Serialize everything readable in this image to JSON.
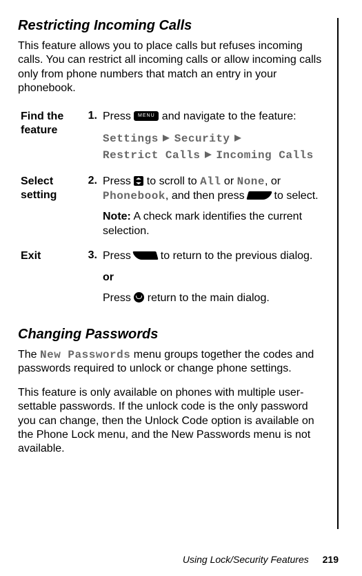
{
  "section1": {
    "title": "Restricting Incoming Calls",
    "intro": "This feature allows you to place calls but refuses incoming calls. You can restrict all incoming calls or allow incoming calls only from phone numbers that match an entry in your phonebook."
  },
  "steps": {
    "row1": {
      "label": "Find the feature",
      "num": "1.",
      "text_a": "Press ",
      "text_b": " and navigate to the feature:",
      "path_settings": "Settings",
      "path_security": "Security",
      "path_restrict": "Restrict Calls",
      "path_incoming": "Incoming Calls",
      "menu_key_label": "MENU"
    },
    "row2": {
      "label": "Select setting",
      "num": "2.",
      "text_a": "Press ",
      "text_b": " to scroll to ",
      "opt_all": "All",
      "text_c": " or ",
      "opt_none": "None",
      "text_d": ", or ",
      "opt_pb": "Phonebook",
      "text_e": ", and then press ",
      "text_f": " to select.",
      "note_label": "Note:",
      "note_text": " A check mark identifies the current selection."
    },
    "row3": {
      "label": "Exit",
      "num": "3.",
      "text_a": "Press ",
      "text_b": " to return to the previous dialog.",
      "or": "or",
      "text_c": "Press ",
      "text_d": " return to the main dialog."
    }
  },
  "section2": {
    "title": "Changing Passwords",
    "p1a": "The ",
    "p1_lcd": "New Passwords",
    "p1b": " menu groups together the codes and passwords required to unlock or change phone settings.",
    "p2": "This feature is only available on phones with multiple user-settable passwords. If the unlock code is the only password you can change, then the Unlock Code option is available on the Phone Lock menu, and the New Passwords menu is not available."
  },
  "footer": {
    "text": "Using Lock/Security Features",
    "page": "219"
  }
}
